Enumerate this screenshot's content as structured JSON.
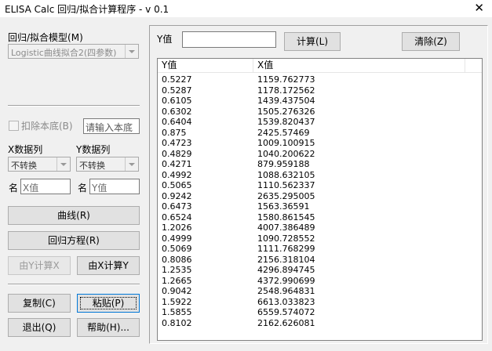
{
  "window": {
    "title": "ELISA Calc 回归/拟合计算程序 - v 0.1",
    "close": "✕"
  },
  "left": {
    "model_label": "回归/拟合模型(M)",
    "model_value": "Logistic曲线拟合2(四参数)",
    "subtract_label": "扣除本底(B)",
    "subtract_placeholder": "请输入本底",
    "x_col_label": "X数据列",
    "y_col_label": "Y数据列",
    "x_transform": "不转换",
    "y_transform": "不转换",
    "name_label": "名",
    "x_name": "X值",
    "y_name": "Y值",
    "curve_btn": "曲线(R)",
    "equation_btn": "回归方程(R)",
    "calc_x_btn": "由Y计算X",
    "calc_y_btn": "由X计算Y",
    "copy_btn": "复制(C)",
    "paste_btn": "粘贴(P)",
    "exit_btn": "退出(Q)",
    "help_btn": "帮助(H)..."
  },
  "right": {
    "y_label": "Y值",
    "y_input": "",
    "calc_btn": "计算(L)",
    "clear_btn": "清除(Z)",
    "columns": [
      "Y值",
      "X值"
    ],
    "rows": [
      [
        "0.5227",
        "1159.762773"
      ],
      [
        "0.5287",
        "1178.172562"
      ],
      [
        "0.6105",
        "1439.437504"
      ],
      [
        "0.6302",
        "1505.276326"
      ],
      [
        "0.6404",
        "1539.820437"
      ],
      [
        "0.875",
        "2425.57469"
      ],
      [
        "0.4723",
        "1009.100915"
      ],
      [
        "0.4829",
        "1040.200622"
      ],
      [
        "0.4271",
        "879.959188"
      ],
      [
        "0.4992",
        "1088.632105"
      ],
      [
        "0.5065",
        "1110.562337"
      ],
      [
        "0.9242",
        "2635.295005"
      ],
      [
        "0.6473",
        "1563.36591"
      ],
      [
        "0.6524",
        "1580.861545"
      ],
      [
        "1.2026",
        "4007.386489"
      ],
      [
        "0.4999",
        "1090.728552"
      ],
      [
        "0.5069",
        "1111.768299"
      ],
      [
        "0.8086",
        "2156.318104"
      ],
      [
        "1.2535",
        "4296.894745"
      ],
      [
        "1.2665",
        "4372.990699"
      ],
      [
        "0.9042",
        "2548.964831"
      ],
      [
        "1.5922",
        "6613.033823"
      ],
      [
        "1.5855",
        "6559.574072"
      ],
      [
        "0.8102",
        "2162.626081"
      ]
    ]
  }
}
